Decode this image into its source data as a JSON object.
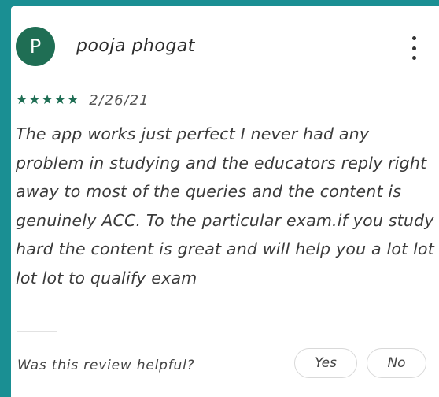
{
  "review": {
    "avatar_letter": "P",
    "author": "pooja phogat",
    "stars": "★★★★★",
    "rating": 5,
    "date": "2/26/21",
    "text": "The app works just perfect I never had any problem in studying and the educators reply right away to most of the queries and the content is genuinely ACC. To the particular exam.if you study hard the content is great and will help you a lot lot lot lot to qualify exam"
  },
  "helpful": {
    "question": "Was this review helpful?",
    "yes_label": "Yes",
    "no_label": "No"
  },
  "colors": {
    "accent": "#1f6e54",
    "frame": "#1a8f93"
  }
}
